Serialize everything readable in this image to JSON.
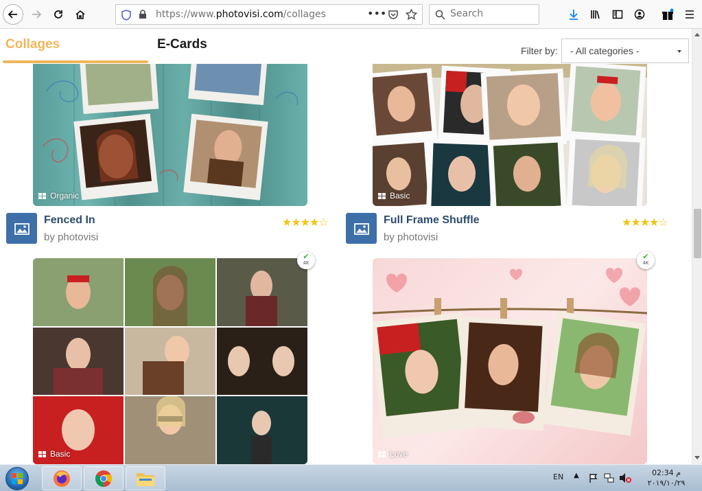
{
  "browser": {
    "url_host": "https://www.",
    "url_domain": "photovisi.com",
    "url_path": "/collages",
    "search_placeholder": "Search"
  },
  "header": {
    "tabs": [
      {
        "label": "Collages",
        "active": true
      },
      {
        "label": "E-Cards",
        "active": false
      }
    ],
    "filter_label": "Filter by:",
    "filter_value": "- All categories -"
  },
  "cards": [
    {
      "category": "Organic"
    },
    {
      "category": "Basic"
    },
    {
      "title": "Fenced In",
      "author": "by photovisi",
      "rating": 4
    },
    {
      "title": "Full Frame Shuffle",
      "author": "by photovisi",
      "rating": 4
    },
    {
      "category": "Basic",
      "badge": "4K"
    },
    {
      "category": "Love",
      "badge": "4K"
    }
  ],
  "taskbar": {
    "lang": "EN",
    "time": "02:34 م",
    "date": "٢٠١٩/١٠/٢٩"
  },
  "colors": {
    "accent": "#f0b65a",
    "title": "#2c4a6e",
    "star": "#f1c40f",
    "app_icon": "#3d6fa8"
  }
}
